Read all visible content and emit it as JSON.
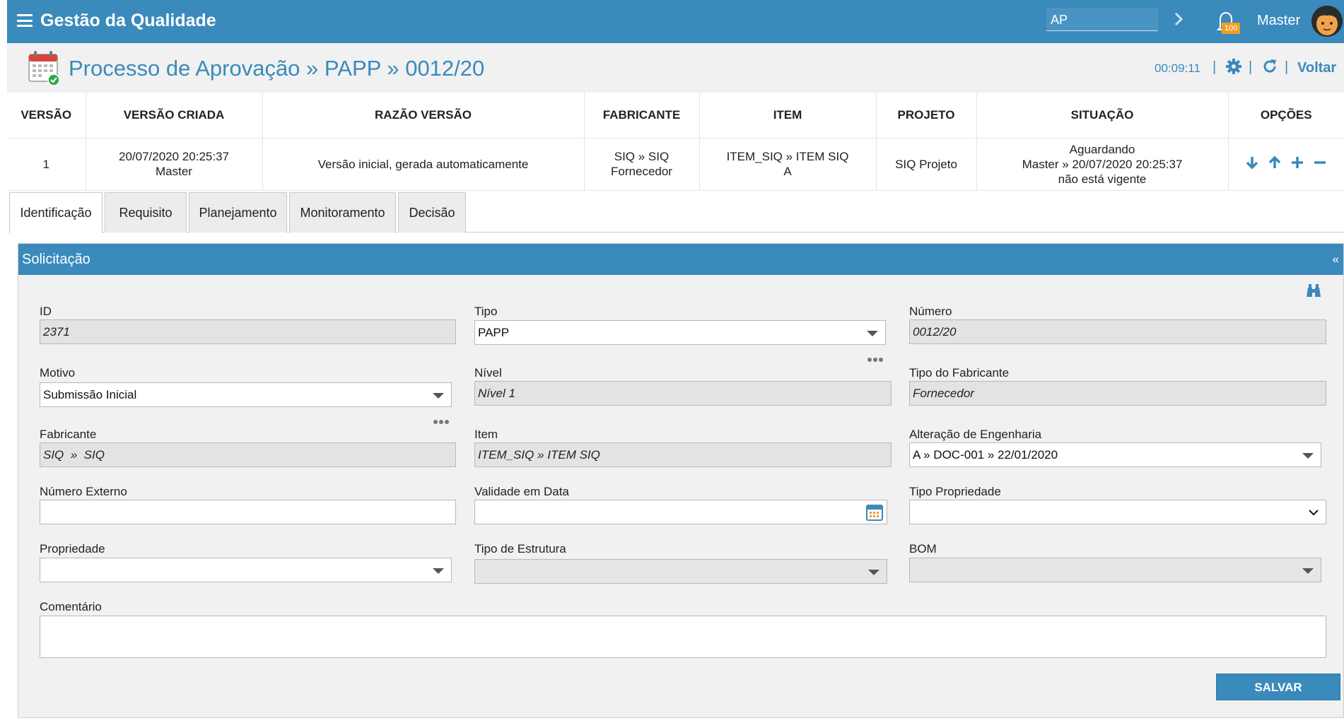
{
  "topbar": {
    "app_title": "Gestão da Qualidade",
    "search_value": "AP",
    "notification_count": "100",
    "user_name": "Master"
  },
  "page": {
    "title": "Processo de Aprovação » PAPP » 0012/20",
    "timer": "00:09:11",
    "back_label": "Voltar"
  },
  "versions": {
    "headers": [
      "VERSÃO",
      "VERSÃO CRIADA",
      "RAZÃO VERSÃO",
      "FABRICANTE",
      "ITEM",
      "PROJETO",
      "SITUAÇÃO",
      "OPÇÕES"
    ],
    "row": {
      "versao": "1",
      "criada_date": "20/07/2020 20:25:37",
      "criada_user": "Master",
      "razao": "Versão inicial, gerada automaticamente",
      "fabricante_1": "SIQ » SIQ",
      "fabricante_2": "Fornecedor",
      "item_1": "ITEM_SIQ » ITEM SIQ",
      "item_2": "A",
      "projeto": "SIQ Projeto",
      "situacao_1": "Aguardando",
      "situacao_2": "Master » 20/07/2020 20:25:37",
      "situacao_3": "não está vigente"
    }
  },
  "tabs": [
    "Identificação",
    "Requisito",
    "Planejamento",
    "Monitoramento",
    "Decisão"
  ],
  "panel": {
    "title": "Solicitação",
    "collapse": "«",
    "save_label": "SALVAR"
  },
  "form": {
    "id_label": "ID",
    "id_value": "2371",
    "tipo_label": "Tipo",
    "tipo_value": "PAPP",
    "numero_label": "Número",
    "numero_value": "0012/20",
    "motivo_label": "Motivo",
    "motivo_value": "Submissão Inicial",
    "nivel_label": "Nível",
    "nivel_value": "Nível 1",
    "tipo_fab_label": "Tipo do Fabricante",
    "tipo_fab_value": "Fornecedor",
    "fabricante_label": "Fabricante",
    "fabricante_value": "SIQ  »  SIQ",
    "item_label": "Item",
    "item_value": "ITEM_SIQ » ITEM SIQ",
    "alt_eng_label": "Alteração de Engenharia",
    "alt_eng_value": "A » DOC-001 » 22/01/2020",
    "num_ext_label": "Número Externo",
    "num_ext_value": "",
    "validade_label": "Validade em Data",
    "validade_value": "",
    "tipo_prop_label": "Tipo Propriedade",
    "tipo_prop_value": "",
    "propriedade_label": "Propriedade",
    "propriedade_value": "",
    "tipo_estrutura_label": "Tipo de Estrutura",
    "tipo_estrutura_value": "",
    "bom_label": "BOM",
    "bom_value": "",
    "comentario_label": "Comentário",
    "comentario_value": ""
  },
  "colors": {
    "primary": "#3a8abc",
    "badge": "#f0a020"
  },
  "icons": [
    "menu-icon",
    "chevron-right-icon",
    "bell-icon",
    "avatar",
    "calendar-check-icon",
    "gear-icon",
    "refresh-icon",
    "arrow-down-icon",
    "arrow-up-icon",
    "plus-icon",
    "minus-icon",
    "binoculars-icon",
    "calendar-icon"
  ]
}
